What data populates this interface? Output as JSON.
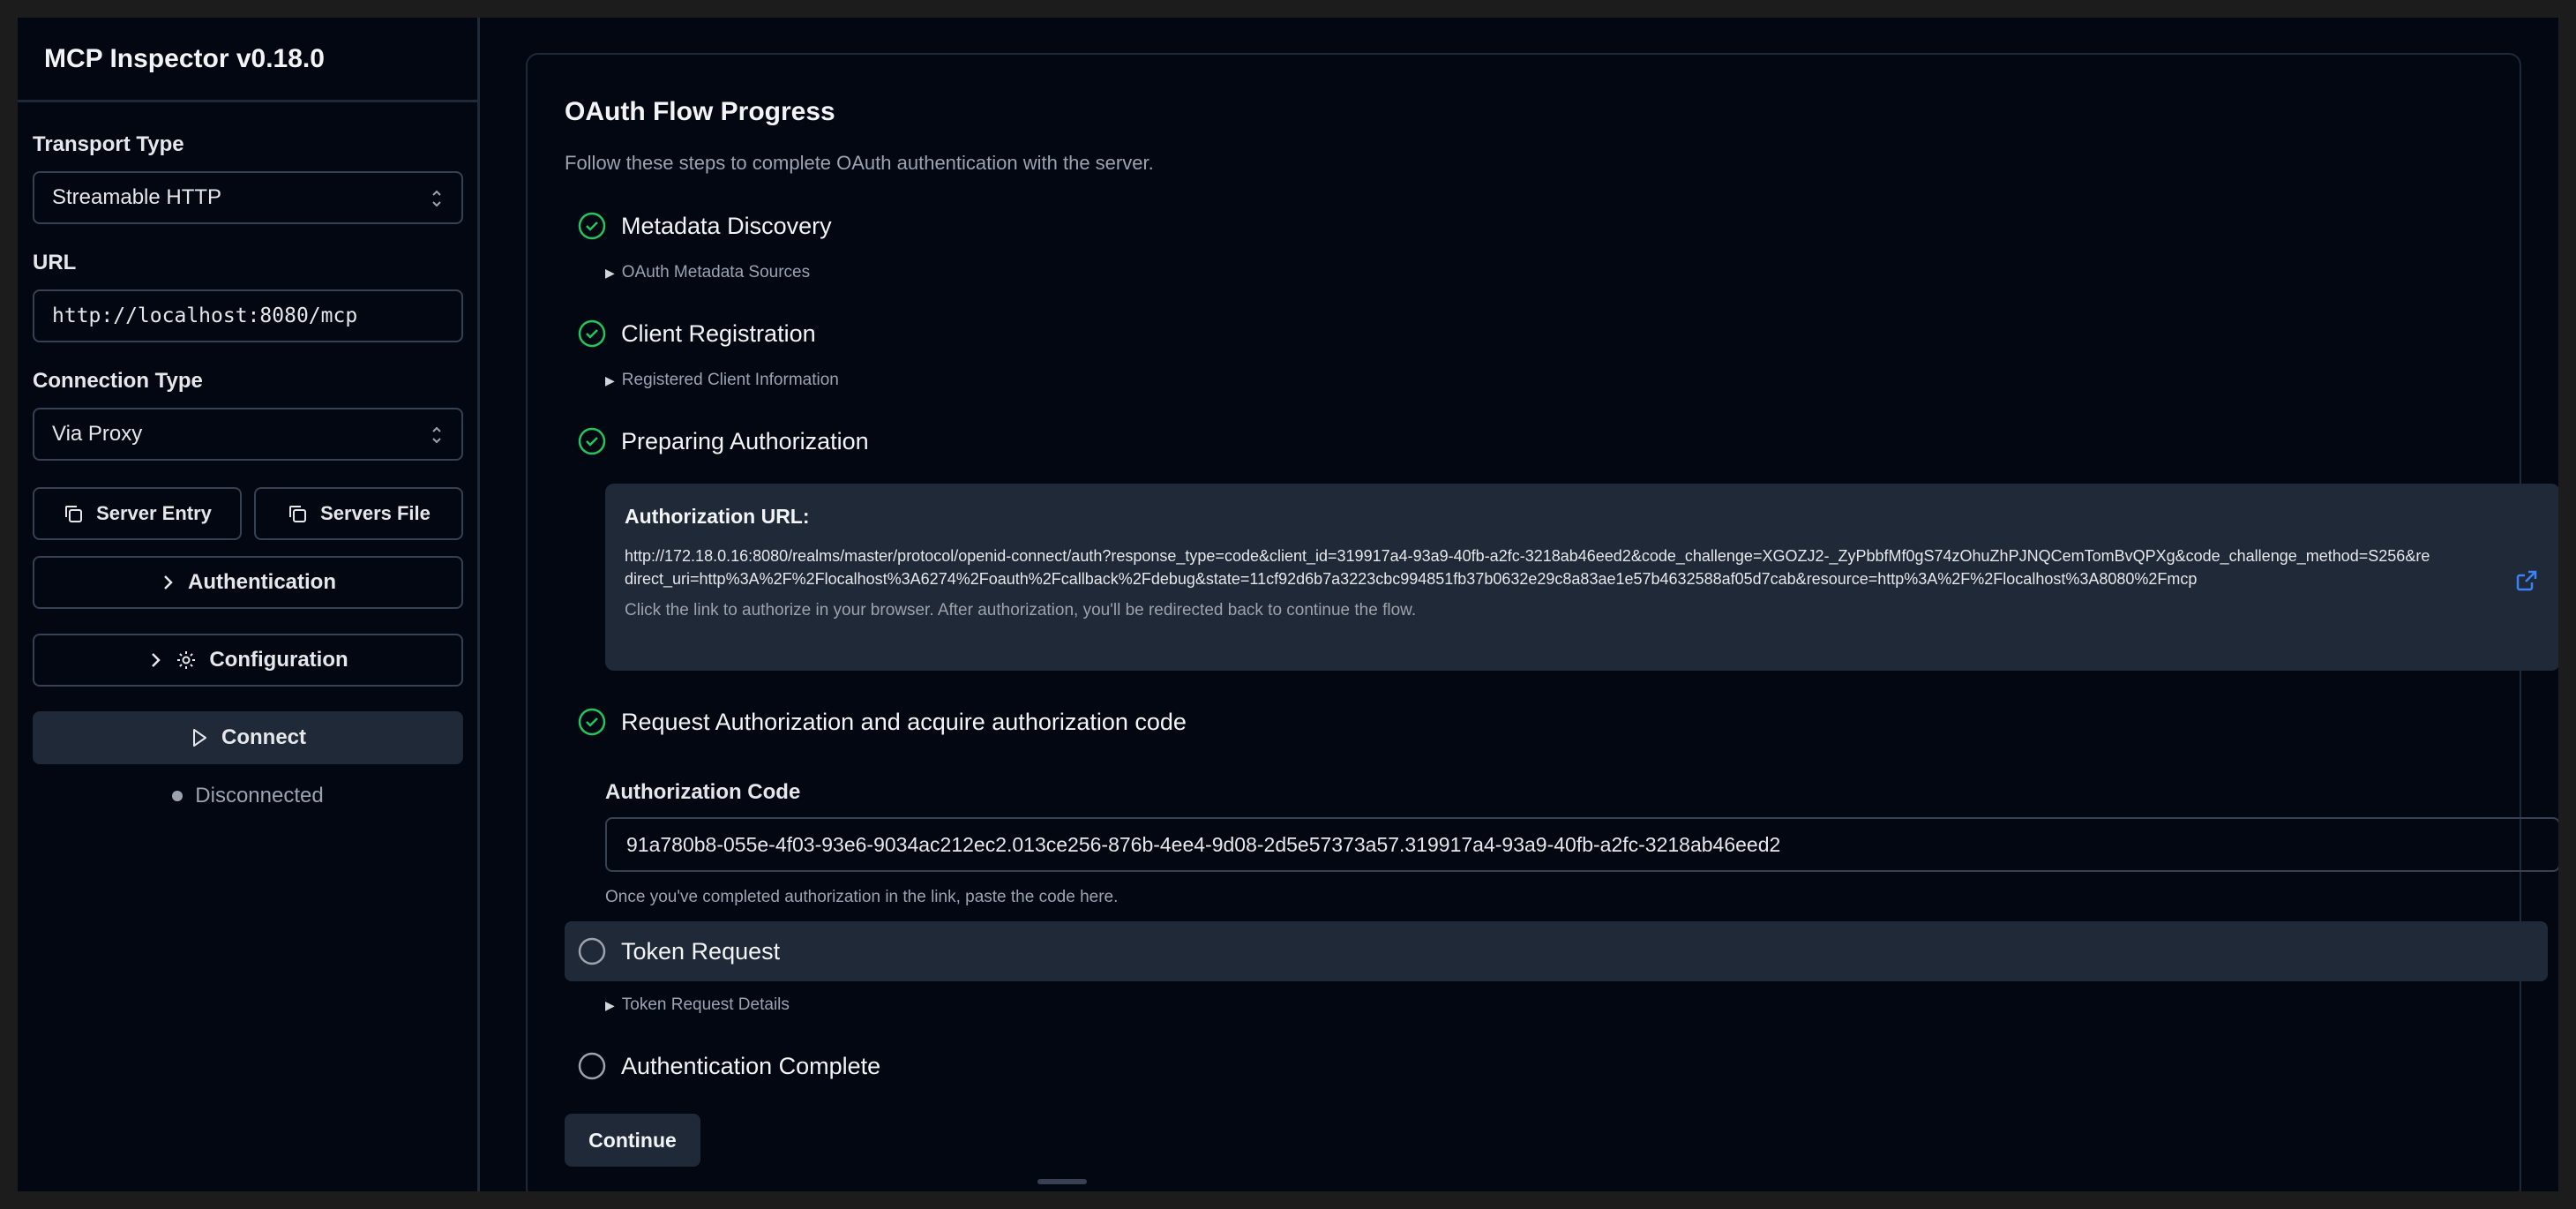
{
  "app": {
    "title": "MCP Inspector v0.18.0"
  },
  "sidebar": {
    "transport_label": "Transport Type",
    "transport_value": "Streamable HTTP",
    "url_label": "URL",
    "url_value": "http://localhost:8080/mcp",
    "connection_label": "Connection Type",
    "connection_value": "Via Proxy",
    "server_entry_label": "Server Entry",
    "servers_file_label": "Servers File",
    "authentication_label": "Authentication",
    "configuration_label": "Configuration",
    "connect_label": "Connect",
    "status_text": "Disconnected"
  },
  "oauth": {
    "title": "OAuth Flow Progress",
    "description": "Follow these steps to complete OAuth authentication with the server.",
    "steps": [
      {
        "label": "Metadata Discovery",
        "done": true,
        "details": "OAuth Metadata Sources"
      },
      {
        "label": "Client Registration",
        "done": true,
        "details": "Registered Client Information"
      },
      {
        "label": "Preparing Authorization",
        "done": true
      },
      {
        "label": "Request Authorization and acquire authorization code",
        "done": true
      },
      {
        "label": "Token Request",
        "done": false,
        "details": "Token Request Details"
      },
      {
        "label": "Authentication Complete",
        "done": false
      }
    ],
    "auth_url_title": "Authorization URL:",
    "auth_url": "http://172.18.0.16:8080/realms/master/protocol/openid-connect/auth?response_type=code&client_id=319917a4-93a9-40fb-a2fc-3218ab46eed2&code_challenge=XGOZJ2-_ZyPbbfMf0gS74zOhuZhPJNQCemTomBvQPXg&code_challenge_method=S256&redirect_uri=http%3A%2F%2Flocalhost%3A6274%2Foauth%2Fcallback%2Fdebug&state=11cf92d6b7a3223cbc994851fb37b0632e29c8a83ae1e57b4632588af05d7cab&resource=http%3A%2F%2Flocalhost%3A8080%2Fmcp",
    "auth_url_hint": "Click the link to authorize in your browser. After authorization, you'll be redirected back to continue the flow.",
    "code_label": "Authorization Code",
    "code_value": "91a780b8-055e-4f03-93e6-9034ac212ec2.013ce256-876b-4ee4-9d08-2d5e57373a57.319917a4-93a9-40fb-a2fc-3218ab46eed2",
    "code_hint": "Once you've completed authorization in the link, paste the code here.",
    "continue_label": "Continue"
  },
  "icons": [
    "chevron-updown-icon",
    "copy-icon",
    "chevron-right-icon",
    "gear-icon",
    "play-icon",
    "check-circle-icon",
    "empty-circle-icon",
    "external-link-icon"
  ],
  "colors": {
    "background": "#030712",
    "panel": "#1f2937",
    "success": "#22c55e",
    "link": "#3b82f6"
  }
}
